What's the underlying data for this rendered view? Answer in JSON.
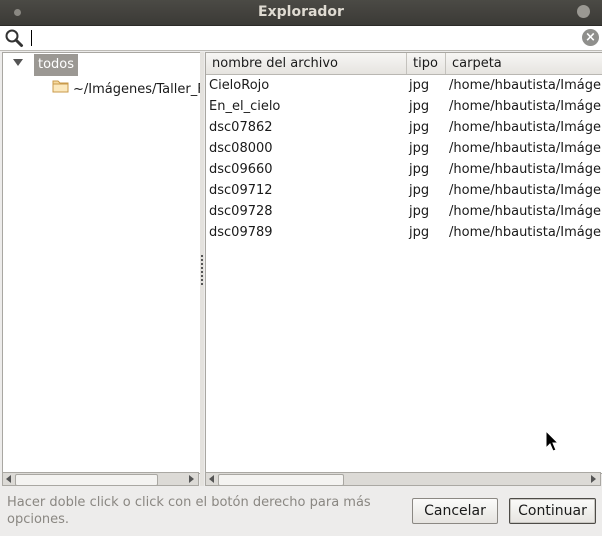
{
  "window": {
    "title": "Explorador"
  },
  "search": {
    "value": "",
    "placeholder": ""
  },
  "tree": {
    "root_label": "todos",
    "children": [
      {
        "label": "~/Imágenes/Taller_F"
      }
    ]
  },
  "table": {
    "columns": [
      "nombre del archivo",
      "tipo",
      "carpeta"
    ],
    "rows": [
      {
        "name": "CieloRojo",
        "type": "jpg",
        "folder": "/home/hbautista/Imágen"
      },
      {
        "name": "En_el_cielo",
        "type": "jpg",
        "folder": "/home/hbautista/Imágen"
      },
      {
        "name": "dsc07862",
        "type": "jpg",
        "folder": "/home/hbautista/Imágen"
      },
      {
        "name": "dsc08000",
        "type": "jpg",
        "folder": "/home/hbautista/Imágen"
      },
      {
        "name": "dsc09660",
        "type": "jpg",
        "folder": "/home/hbautista/Imágen"
      },
      {
        "name": "dsc09712",
        "type": "jpg",
        "folder": "/home/hbautista/Imágen"
      },
      {
        "name": "dsc09728",
        "type": "jpg",
        "folder": "/home/hbautista/Imágen"
      },
      {
        "name": "dsc09789",
        "type": "jpg",
        "folder": "/home/hbautista/Imágen"
      }
    ]
  },
  "footer": {
    "hint": "Hacer doble click o click con el botón derecho para más opciones.",
    "cancel_label": "Cancelar",
    "continue_label": "Continuar"
  },
  "colors": {
    "titlebar": "#3f3e3a",
    "selection": "#9b9893",
    "window_bg": "#edeceb"
  }
}
